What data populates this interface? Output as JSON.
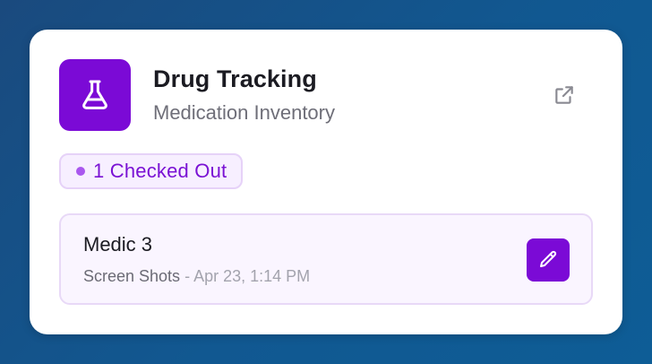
{
  "widget": {
    "title": "Drug Tracking",
    "subtitle": "Medication Inventory",
    "app_icon": "flask-icon",
    "link_icon": "external-link-icon",
    "accent_color": "#7b0ad6"
  },
  "status_badge": {
    "label": "1 Checked Out",
    "dot_color": "#a957ee"
  },
  "entry": {
    "title": "Medic 3",
    "source": "Screen Shots",
    "separator": " - ",
    "timestamp": "Apr 23, 1:14 PM",
    "action_icon": "pencil-icon"
  }
}
